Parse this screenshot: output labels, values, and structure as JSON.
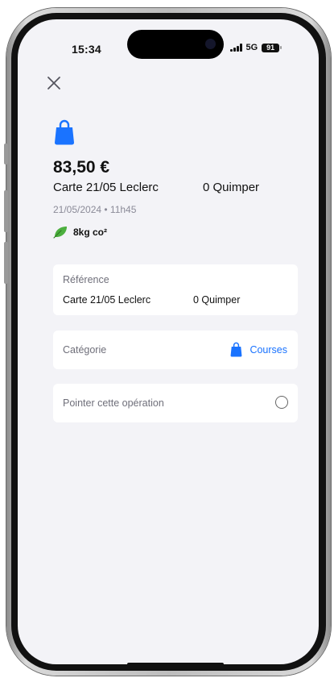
{
  "status_bar": {
    "time": "15:34",
    "network": "5G",
    "battery": "91"
  },
  "icons": {
    "close": "close-icon",
    "category": "shopping-bag-icon",
    "eco": "leaf-icon"
  },
  "colors": {
    "accent": "#1a73ff",
    "eco_green": "#4caf3f",
    "background": "#f3f3f7",
    "card": "#ffffff"
  },
  "transaction": {
    "amount": "83,50 €",
    "label_left": "Carte 21/05 Leclerc",
    "label_right": "0 Quimper",
    "date": "21/05/2024 • 11h45",
    "co2": "8kg co²"
  },
  "reference": {
    "label": "Référence",
    "value_left": "Carte 21/05 Leclerc",
    "value_right": "0 Quimper"
  },
  "category": {
    "label": "Catégorie",
    "value": "Courses"
  },
  "pointer": {
    "label": "Pointer cette opération",
    "checked": false
  }
}
